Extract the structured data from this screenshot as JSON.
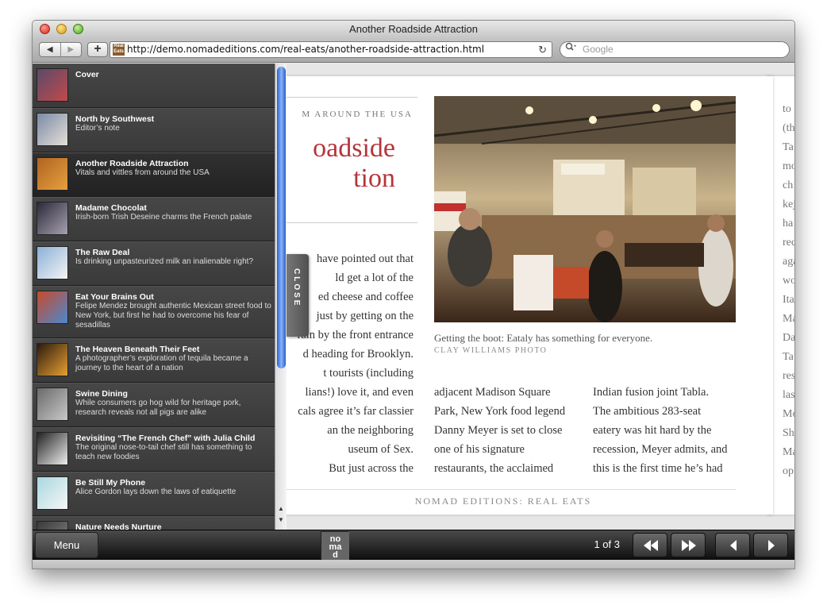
{
  "window": {
    "title": "Another Roadside Attraction"
  },
  "toolbar": {
    "url": "http://demo.nomadeditions.com/real-eats/another-roadside-attraction.html",
    "search_placeholder": "Google",
    "favicon_text": "Real Eats"
  },
  "toc": {
    "items": [
      {
        "title": "Cover",
        "desc": ""
      },
      {
        "title": "North by Southwest",
        "desc": "Editor’s note"
      },
      {
        "title": "Another Roadside Attraction",
        "desc": "Vitals and vittles from around the USA"
      },
      {
        "title": "Madame Chocolat",
        "desc": "Irish-born Trish Deseine charms the French palate"
      },
      {
        "title": "The Raw Deal",
        "desc": "Is drinking unpasteurized milk an inalienable right?"
      },
      {
        "title": "Eat Your Brains Out",
        "desc": "Felipe Mendez brought authentic Mexican street food to New York, but first he had to overcome his fear of sesadillas"
      },
      {
        "title": "The Heaven Beneath Their Feet",
        "desc": "A photographer’s exploration of tequila became a journey to the heart of a nation"
      },
      {
        "title": "Swine Dining",
        "desc": "While consumers go hog wild for heritage pork, research reveals not all pigs are alike"
      },
      {
        "title": "Revisiting “The French Chef” with Julia Child",
        "desc": "The original nose-to-tail chef still has something to teach new foodies"
      },
      {
        "title": "Be Still My Phone",
        "desc": "Alice Gordon lays down the laws of eatiquette"
      },
      {
        "title": "Nature Needs Nurture",
        "desc": ""
      }
    ],
    "close_label": "CLOSE"
  },
  "article": {
    "kicker": "M AROUND THE USA",
    "headline_line1": "oadside",
    "headline_line2": "tion",
    "col1": [
      "have pointed out that",
      "ld get a lot of the",
      "ed cheese and coffee",
      "just by getting on the",
      "rain by the front entrance",
      "d heading for Brooklyn.",
      "t tourists (including",
      "lians!) love it, and even",
      "cals agree it’s far classier",
      "an the neighboring",
      "useum of Sex.",
      "But just across the"
    ],
    "col2": [
      "adjacent Madison Square",
      "Park, New York food legend",
      "Danny Meyer is set to close",
      "one of his signature",
      "restaurants, the acclaimed"
    ],
    "col3": [
      "Indian fusion joint Tabla.",
      "The ambitious 283-seat",
      "eatery was hit hard by the",
      "recession, Meyer admits, and",
      "this is the first time he’s had"
    ],
    "photo_caption": "Getting the boot: Eataly has something for everyone.",
    "photo_credit": "CLAY WILLIAMS PHOTO",
    "footer": "NOMAD EDITIONS: REAL EATS"
  },
  "next_page_fragments": [
    "to",
    "(th",
    "Ta",
    "mo",
    "ch",
    "kej",
    "ha",
    "rec",
    "aga",
    "wo",
    "Ita",
    "Ma",
    "Da",
    "Ta",
    "res",
    "las",
    "Mo",
    "Sh",
    "Ma",
    "op"
  ],
  "bottombar": {
    "menu_label": "Menu",
    "page_count": "1 of 3",
    "logo_text": "no ma d"
  },
  "colors": {
    "headline": "#b5343a",
    "scroll_thumb": "#2a5fd0"
  },
  "icons": {
    "back": "back-arrow-icon",
    "forward": "forward-arrow-icon",
    "reload": "reload-icon",
    "search": "search-icon",
    "first": "rewind-icon",
    "last": "fast-forward-icon",
    "prev": "prev-arrow-icon",
    "next": "next-arrow-icon"
  }
}
